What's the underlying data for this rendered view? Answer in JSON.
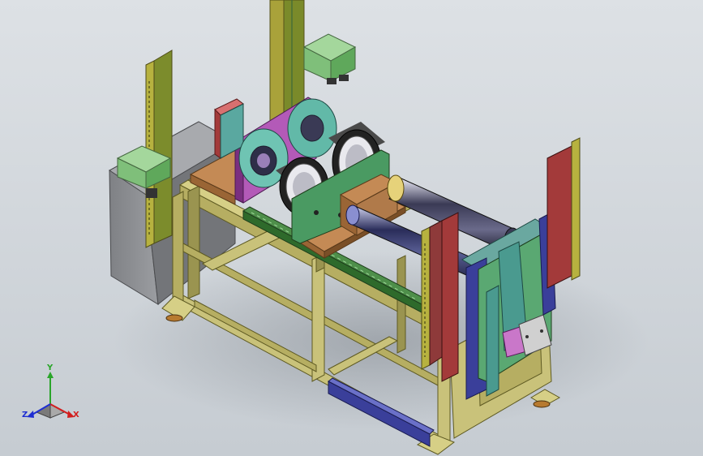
{
  "view": {
    "background_top": "#dde1e5",
    "background_bottom": "#c6ccd2",
    "frame_color": "#c9c27a",
    "frame_dark": "#9a9450",
    "cabinet_color": "#8d8f92",
    "light_curtain_color": "#a6a23a",
    "junction_box_color": "#8fc88a",
    "red_panel_color": "#a33a3a",
    "magenta_plate_color": "#b35ab8",
    "teal_disc_color": "#62b9a8",
    "wood_color": "#b07a4a",
    "green_plate_color": "#3f8f5a",
    "blue_rail_color": "#3a3f9a"
  },
  "triad": {
    "x_label": "X",
    "y_label": "Y",
    "z_label": "Z",
    "x_color": "#d21e1e",
    "y_color": "#2aa52a",
    "z_color": "#1e2ed2"
  }
}
